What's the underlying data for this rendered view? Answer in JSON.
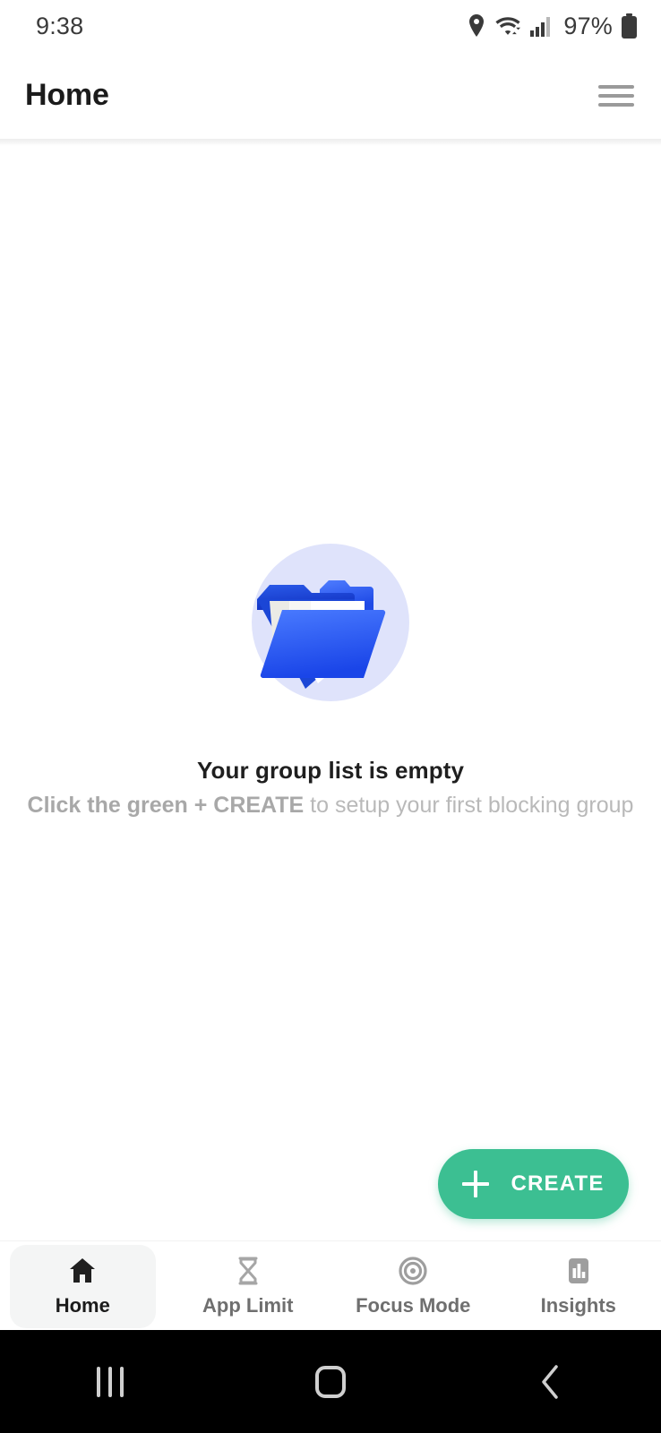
{
  "statusbar": {
    "time": "9:38",
    "battery_percent": "97%",
    "icons": [
      "location-pin-icon",
      "wifi-icon",
      "cellular-signal-icon",
      "battery-icon"
    ]
  },
  "appbar": {
    "title": "Home",
    "menu_icon": "hamburger-menu-icon"
  },
  "empty_state": {
    "illustration": "open-folder-illustration",
    "title": "Your group list is empty",
    "subtitle_strong": "Click the green + CREATE",
    "subtitle_light": " to setup your first blocking group"
  },
  "fab": {
    "label": "CREATE",
    "icon": "plus-icon",
    "color": "#3cbf92"
  },
  "bottom_nav": {
    "items": [
      {
        "label": "Home",
        "icon": "home-icon",
        "active": true
      },
      {
        "label": "App Limit",
        "icon": "hourglass-icon",
        "active": false
      },
      {
        "label": "Focus Mode",
        "icon": "target-icon",
        "active": false
      },
      {
        "label": "Insights",
        "icon": "bar-chart-icon",
        "active": false
      }
    ]
  },
  "system_nav": {
    "recents": "recents-icon",
    "home": "system-home-icon",
    "back": "back-icon"
  },
  "colors": {
    "accent_green": "#3cbf92",
    "folder_blue": "#2f63f0",
    "folder_dark_blue": "#1e4fd8",
    "illustration_bg": "#dfe3fb"
  }
}
